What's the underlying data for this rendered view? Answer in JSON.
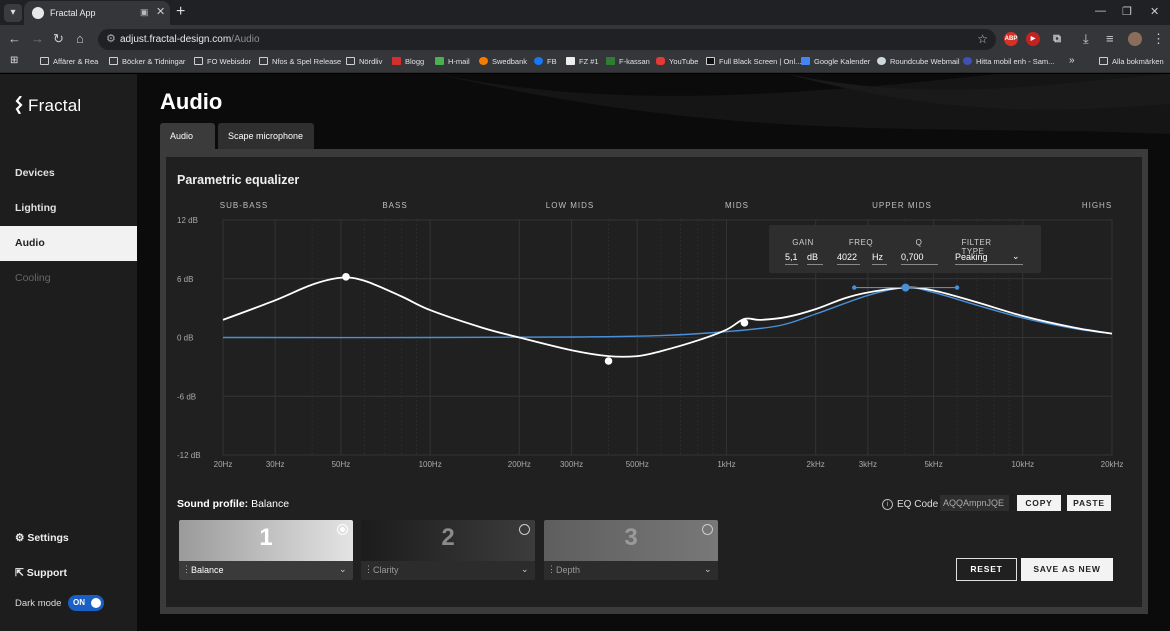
{
  "browser": {
    "tab_title": "Fractal App",
    "url_host": "adjust.fractal-design.com",
    "url_path": "/Audio",
    "bookmarks": [
      {
        "label": "Affärer & Rea",
        "icon": "folder-icon"
      },
      {
        "label": "Böcker & Tidningar",
        "icon": "folder-icon"
      },
      {
        "label": "FO Webisdor",
        "icon": "folder-icon"
      },
      {
        "label": "Nfos & Spel Release",
        "icon": "folder-icon"
      },
      {
        "label": "Nördliv",
        "icon": "folder-icon"
      },
      {
        "label": "Blogg",
        "icon": "blogg-icon"
      },
      {
        "label": "H-mail",
        "icon": "mail-icon"
      },
      {
        "label": "Swedbank",
        "icon": "swedbank-icon"
      },
      {
        "label": "FB",
        "icon": "facebook-icon"
      },
      {
        "label": "FZ #1",
        "icon": "fz-icon"
      },
      {
        "label": "F-kassan",
        "icon": "fkassan-icon"
      },
      {
        "label": "YouTube",
        "icon": "youtube-icon"
      },
      {
        "label": "Full Black Screen | Onl...",
        "icon": "screen-icon"
      },
      {
        "label": "Google Kalender",
        "icon": "calendar-icon"
      },
      {
        "label": "Roundcube Webmail",
        "icon": "roundcube-icon"
      },
      {
        "label": "Hitta mobil enh - Sam...",
        "icon": "location-icon"
      }
    ],
    "all_bookmarks": "Alla bokmärken",
    "ext_abp": "ABP"
  },
  "sidebar": {
    "logo": "Fractal",
    "items": [
      {
        "label": "Devices",
        "state": "normal"
      },
      {
        "label": "Lighting",
        "state": "normal"
      },
      {
        "label": "Audio",
        "state": "active"
      },
      {
        "label": "Cooling",
        "state": "disabled"
      }
    ],
    "settings": "Settings",
    "support": "Support",
    "dark_mode_label": "Dark mode",
    "dark_mode_value": "ON"
  },
  "page": {
    "title": "Audio",
    "tabs": [
      "Audio",
      "Scape microphone"
    ]
  },
  "equalizer": {
    "title": "Parametric equalizer",
    "bands": [
      "SUB-BASS",
      "BASS",
      "LOW MIDS",
      "MIDS",
      "UPPER MIDS",
      "HIGHS"
    ],
    "popup": {
      "gain_label": "GAIN",
      "gain_value": "5,1",
      "gain_unit": "dB",
      "freq_label": "FREQ",
      "freq_value": "4022",
      "freq_unit": "Hz",
      "q_label": "Q",
      "q_value": "0,700",
      "filter_label": "FILTER TYPE",
      "filter_value": "Peaking"
    }
  },
  "chart_data": {
    "type": "line",
    "x_scale": "log",
    "xlim": [
      20,
      20000
    ],
    "ylim": [
      -12,
      12
    ],
    "x_ticks": [
      20,
      30,
      50,
      100,
      200,
      300,
      500,
      1000,
      2000,
      3000,
      5000,
      10000,
      20000
    ],
    "x_tick_labels": [
      "20Hz",
      "30Hz",
      "50Hz",
      "100Hz",
      "200Hz",
      "300Hz",
      "500Hz",
      "1kHz",
      "2kHz",
      "3kHz",
      "5kHz",
      "10kHz",
      "20kHz"
    ],
    "y_ticks": [
      12,
      6,
      0,
      -6,
      -12
    ],
    "y_tick_labels": [
      "12 dB",
      "6 dB",
      "0 dB",
      "-6 dB",
      "-12 dB"
    ],
    "series": [
      {
        "curve": "combined",
        "color": "#ffffff",
        "x": [
          20,
          30,
          40,
          50,
          60,
          80,
          100,
          150,
          200,
          300,
          400,
          500,
          600,
          800,
          1000,
          1150,
          1300,
          1600,
          2000,
          2500,
          3000,
          4022,
          5000,
          7000,
          10000,
          15000,
          20000
        ],
        "y": [
          1.8,
          3.8,
          5.4,
          6.1,
          5.8,
          4.2,
          2.8,
          1.0,
          0.0,
          -1.3,
          -1.9,
          -1.9,
          -1.4,
          -0.3,
          0.8,
          1.9,
          1.8,
          2.1,
          2.9,
          4.0,
          4.6,
          5.1,
          4.8,
          3.6,
          2.2,
          1.0,
          0.4
        ]
      },
      {
        "curve": "selected-filter",
        "color": "#4a90d9",
        "x": [
          20,
          100,
          300,
          600,
          1000,
          1500,
          2000,
          3000,
          4022,
          5000,
          7000,
          10000,
          15000,
          20000
        ],
        "y": [
          0.0,
          0.0,
          0.05,
          0.2,
          0.6,
          1.2,
          2.4,
          4.3,
          5.1,
          4.6,
          3.3,
          2.0,
          0.9,
          0.4
        ]
      }
    ],
    "points": [
      {
        "x": 52,
        "y": 6.2,
        "selected": false
      },
      {
        "x": 400,
        "y": -2.4,
        "selected": false
      },
      {
        "x": 1150,
        "y": 1.5,
        "selected": false
      },
      {
        "x": 4022,
        "y": 5.1,
        "selected": true,
        "handle_left_x": 2700,
        "handle_right_x": 6000
      }
    ],
    "grid": true
  },
  "sound_profile": {
    "label": "Sound profile:",
    "value": "Balance",
    "eq_code_label": "EQ Code",
    "eq_code": "AQQAmpnJQE",
    "copy": "COPY",
    "paste": "PASTE",
    "presets": [
      {
        "number": "1",
        "name": "Balance",
        "selected": true
      },
      {
        "number": "2",
        "name": "Clarity",
        "selected": false
      },
      {
        "number": "3",
        "name": "Depth",
        "selected": false
      }
    ],
    "reset": "RESET",
    "save_as_new": "SAVE AS NEW"
  }
}
